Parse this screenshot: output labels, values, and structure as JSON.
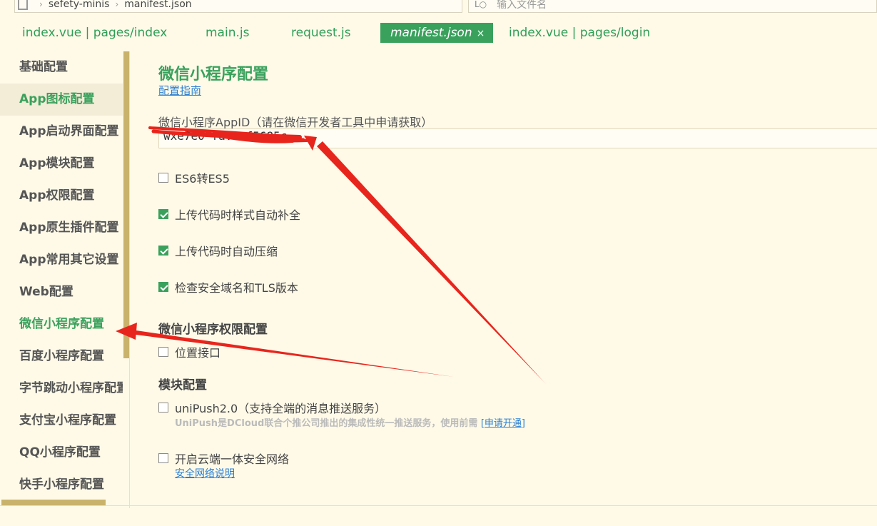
{
  "breadcrumb": {
    "project": "sefety-minis",
    "file": "manifest.json"
  },
  "file_search": {
    "placeholder": "输入文件名"
  },
  "tabs": [
    {
      "label": "index.vue | pages/index"
    },
    {
      "label": "main.js"
    },
    {
      "label": "request.js"
    },
    {
      "label": "manifest.json",
      "close": "×"
    },
    {
      "label": "index.vue | pages/login"
    }
  ],
  "sidebar": {
    "items": [
      {
        "label": "基础配置"
      },
      {
        "label": "App图标配置"
      },
      {
        "label": "App启动界面配置"
      },
      {
        "label": "App模块配置"
      },
      {
        "label": "App权限配置"
      },
      {
        "label": "App原生插件配置"
      },
      {
        "label": "App常用其它设置"
      },
      {
        "label": "Web配置"
      },
      {
        "label": "微信小程序配置"
      },
      {
        "label": "百度小程序配置"
      },
      {
        "label": "字节跳动小程序配置"
      },
      {
        "label": "支付宝小程序配置"
      },
      {
        "label": "QQ小程序配置"
      },
      {
        "label": "快手小程序配置"
      }
    ]
  },
  "main": {
    "title": "微信小程序配置",
    "guide_link": "配置指南",
    "appid_label": "微信小程序AppID（请在微信开发者工具中申请获取）",
    "appid_value": "wxe7e0 fa...f5685c",
    "options": [
      {
        "label": "ES6转ES5",
        "checked": false
      },
      {
        "label": "上传代码时样式自动补全",
        "checked": true
      },
      {
        "label": "上传代码时自动压缩",
        "checked": true
      },
      {
        "label": "检查安全域名和TLS版本",
        "checked": true
      }
    ],
    "permission_heading": "微信小程序权限配置",
    "permission_location": "位置接口",
    "module_heading": "模块配置",
    "unipush_label": "uniPush2.0（支持全端的消息推送服务）",
    "unipush_note": "UniPush是DCloud联合个推公司推出的集成性统一推送服务，使用前需",
    "unipush_note_link": "[申请开通]",
    "secure_network_label": "开启云端一体安全网络",
    "secure_network_link": "安全网络说明"
  },
  "colors": {
    "background": "#fffae8",
    "accent": "#3aa15d",
    "link": "#2a7fd4",
    "annotation": "#e8251c"
  }
}
